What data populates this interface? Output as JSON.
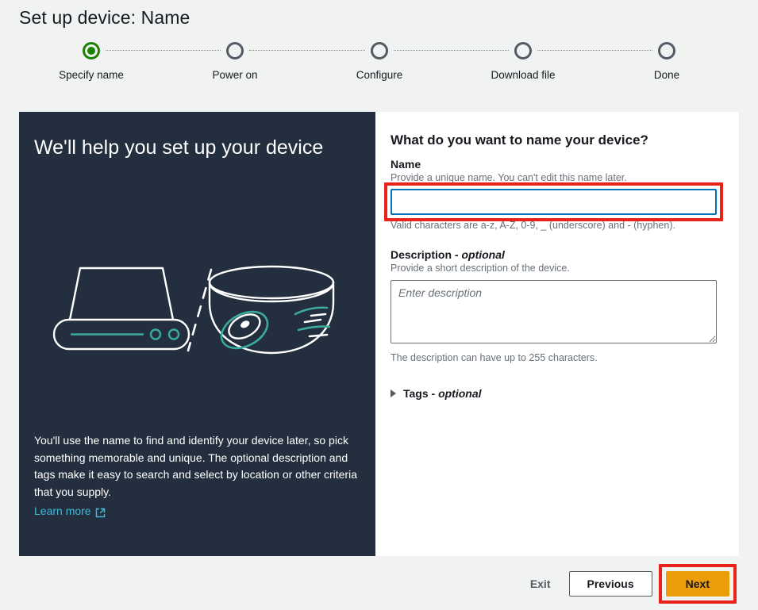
{
  "page": {
    "title": "Set up device: Name"
  },
  "stepper": {
    "steps": [
      {
        "label": "Specify name",
        "state": "active"
      },
      {
        "label": "Power on",
        "state": "inactive"
      },
      {
        "label": "Configure",
        "state": "inactive"
      },
      {
        "label": "Download file",
        "state": "inactive"
      },
      {
        "label": "Done",
        "state": "inactive"
      }
    ]
  },
  "info_panel": {
    "heading": "We'll help you set up your device",
    "body": "You'll use the name to find and identify your device later, so pick something memorable and unique. The optional description and tags make it easy to search and select by location or other criteria that you supply.",
    "learn_more_label": "Learn more",
    "learn_more_icon": "external-link-icon",
    "illustration_alt": "appliance-and-camera-illustration"
  },
  "form": {
    "title": "What do you want to name your device?",
    "name": {
      "label": "Name",
      "description": "Provide a unique name. You can't edit this name later.",
      "value": "",
      "placeholder": "",
      "hint": "Valid characters are a-z, A-Z, 0-9, _ (underscore) and - (hyphen)."
    },
    "description": {
      "label": "Description - optional",
      "label_main": "Description - ",
      "label_optional": "optional",
      "description": "Provide a short description of the device.",
      "value": "",
      "placeholder": "Enter description",
      "hint": "The description can have up to 255 characters."
    },
    "tags": {
      "label_main": "Tags - ",
      "label_optional": "optional",
      "expanded": false,
      "icon": "triangle-right-icon"
    }
  },
  "footer": {
    "exit_label": "Exit",
    "previous_label": "Previous",
    "next_label": "Next"
  },
  "colors": {
    "background": "#f1f3f3",
    "panel_dark": "#232f3e",
    "accent_green": "#1d8102",
    "accent_orange": "#ec9d09",
    "focus_blue": "#0073bb",
    "highlight_red": "#e8231a",
    "link_blue": "#44b9d6",
    "illustration_teal": "#3aab9b"
  }
}
